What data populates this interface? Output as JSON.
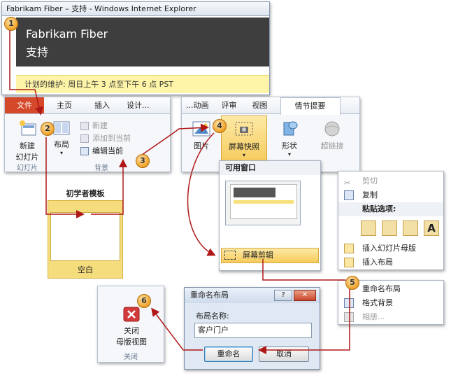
{
  "ie": {
    "title": "Fabrikam Fiber – 支持 - Windows Internet Explorer",
    "brand": "Fabrikam Fiber",
    "subtitle": "支持",
    "warning": "计划的维护:  周日上午 3 点至下午 6 点 PST"
  },
  "ribbon1": {
    "tabs": [
      "文件",
      "主页",
      "插入",
      "设计..."
    ],
    "new_slide": "新建",
    "new_slide2": "幻灯片",
    "layout": "布局",
    "new_item": "新建",
    "add_to_current": "添加到当前",
    "edit_current": "编辑当前",
    "group_slides": "幻灯片",
    "group_background": "背景"
  },
  "ribbon2": {
    "tabs": [
      "...动画",
      "评审",
      "视图",
      "情节提要"
    ],
    "picture": "图片",
    "screenshot": "屏幕快照",
    "shape": "形状",
    "hyperlink": "超链接"
  },
  "template": {
    "heading": "初学者模板",
    "blank": "空白"
  },
  "dropdown": {
    "available": "可用窗口",
    "clipping": "屏幕剪辑"
  },
  "context_menu": {
    "cut": "剪切",
    "copy": "复制",
    "paste_options": "粘贴选项:",
    "insert_master": "插入幻灯片母版",
    "insert_layout": "插入布局",
    "rename_layout": "重命名布局",
    "format_background": "格式背景",
    "phase": "相册..."
  },
  "close_panel": {
    "close": "关闭",
    "master_view": "母版视图",
    "group": "关闭"
  },
  "dialog": {
    "title": "重命名布局",
    "help": "?",
    "close": "✕",
    "label": "布局名称:",
    "value": "客户门户",
    "rename": "重命名",
    "cancel": "取消"
  },
  "callouts": [
    "1",
    "2",
    "3",
    "4",
    "5",
    "6"
  ],
  "colors": {
    "arrow": "#b01818",
    "callout": "#f0a227",
    "file_tab": "#d5482a",
    "warning_bg": "#fff5a8"
  }
}
